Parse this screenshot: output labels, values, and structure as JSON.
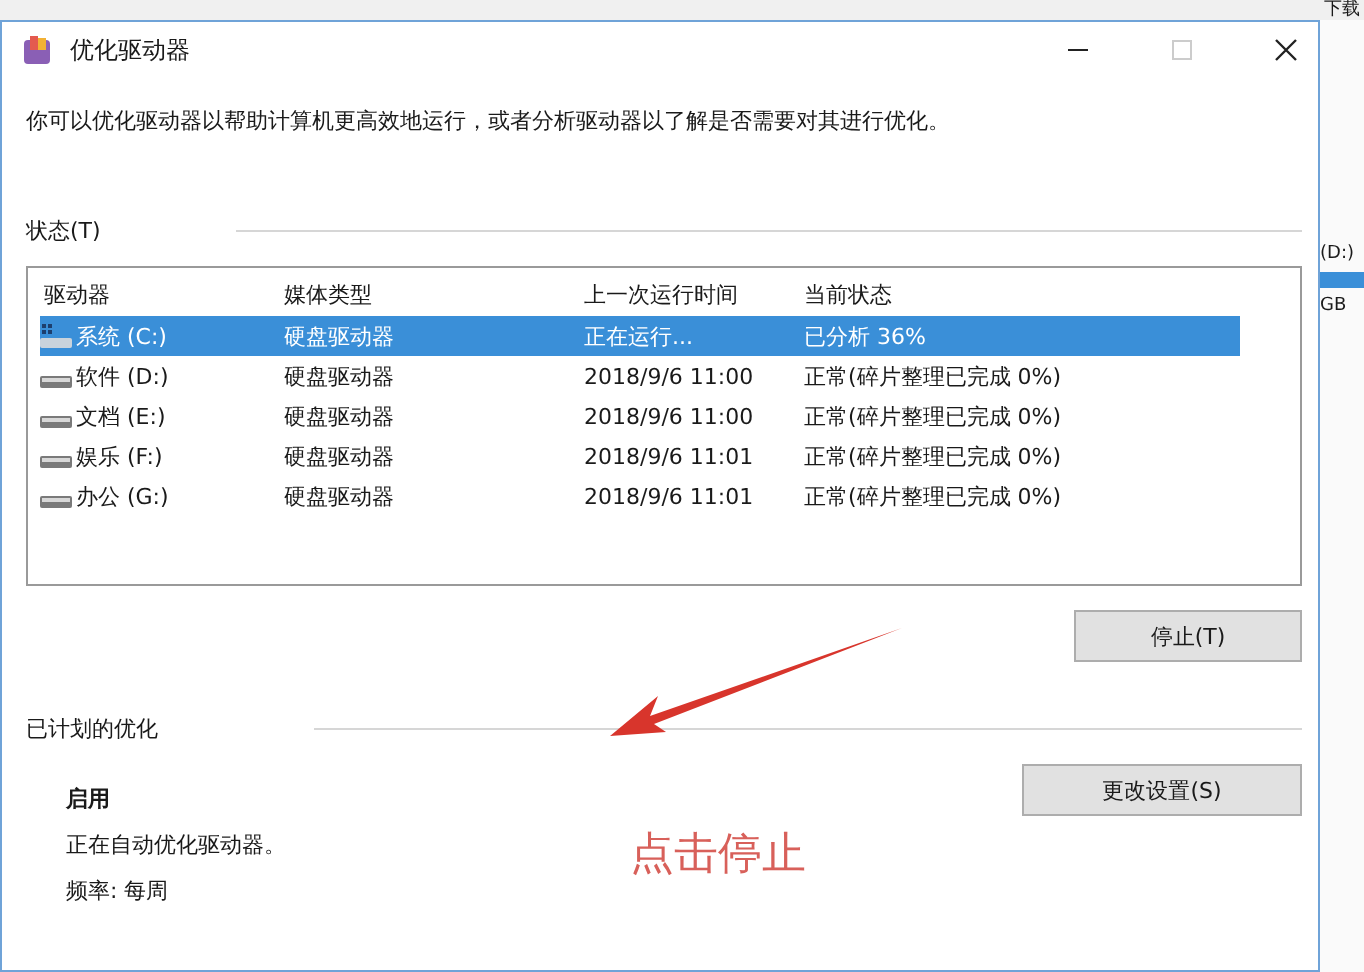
{
  "background_window": {
    "texts": [
      "下载",
      "(D:)",
      "GB"
    ]
  },
  "window": {
    "title": "优化驱动器"
  },
  "description": "你可以优化驱动器以帮助计算机更高效地运行，或者分析驱动器以了解是否需要对其进行优化。",
  "status": {
    "heading": "状态(T)",
    "table": {
      "columns": [
        "驱动器",
        "媒体类型",
        "上一次运行时间",
        "当前状态"
      ],
      "rows": [
        {
          "kind": "system",
          "selected": true,
          "cells": [
            "系统 (C:)",
            "硬盘驱动器",
            "正在运行...",
            "已分析 36%"
          ]
        },
        {
          "kind": "drive",
          "selected": false,
          "cells": [
            "软件 (D:)",
            "硬盘驱动器",
            "2018/9/6 11:00",
            "正常(碎片整理已完成 0%)"
          ]
        },
        {
          "kind": "drive",
          "selected": false,
          "cells": [
            "文档 (E:)",
            "硬盘驱动器",
            "2018/9/6 11:00",
            "正常(碎片整理已完成 0%)"
          ]
        },
        {
          "kind": "drive",
          "selected": false,
          "cells": [
            "娱乐 (F:)",
            "硬盘驱动器",
            "2018/9/6 11:01",
            "正常(碎片整理已完成 0%)"
          ]
        },
        {
          "kind": "drive",
          "selected": false,
          "cells": [
            "办公 (G:)",
            "硬盘驱动器",
            "2018/9/6 11:01",
            "正常(碎片整理已完成 0%)"
          ]
        }
      ]
    },
    "button": "停止(T)"
  },
  "scheduled": {
    "heading": "已计划的优化",
    "state": "启用",
    "lines": [
      "正在自动优化驱动器。",
      "频率: 每周"
    ],
    "button": "更改设置(S)"
  },
  "annotation": "点击停止"
}
